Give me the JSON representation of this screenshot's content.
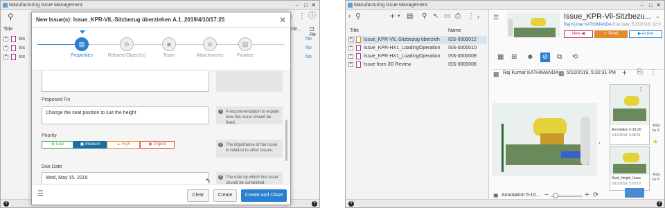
{
  "left_window": {
    "title": "Manufacturing Issue Management",
    "tree_header": "Title",
    "col_partial_1": "erfe...",
    "col_partial_2": "Re",
    "rows": [
      {
        "title": "Iss",
        "value": "No"
      },
      {
        "title": "Iss",
        "value": "No"
      },
      {
        "title": "Iss",
        "value": "No"
      }
    ]
  },
  "dialog": {
    "title": "New Issue(s): Issue_KPR-VIL-Sitzbezug überziehen A.1_2019/4/10/17:25",
    "steps": [
      {
        "label": "Properties",
        "active": true,
        "icon": "clipboard-icon"
      },
      {
        "label": "Related Object(s)",
        "active": false,
        "icon": "link-icon"
      },
      {
        "label": "Team",
        "active": false,
        "icon": "team-icon"
      },
      {
        "label": "Attachments",
        "active": false,
        "icon": "paperclip-icon"
      },
      {
        "label": "Finalize",
        "active": false,
        "icon": "flag-icon"
      }
    ],
    "proposed_fix_label": "Proposed Fix",
    "proposed_fix_value": "Change the seat position to suit the height",
    "proposed_fix_help": "A recommendation to explain how this issue should be fixed.",
    "priority_label": "Priority",
    "priorities": [
      {
        "label": "Low",
        "color": "#3aa856",
        "selected": false
      },
      {
        "label": "Medium",
        "color": "#1a6f9e",
        "selected": true
      },
      {
        "label": "High",
        "color": "#e08a2c",
        "selected": false
      },
      {
        "label": "Urgent",
        "color": "#d9472b",
        "selected": false
      }
    ],
    "priority_help": "The importance of the issue in relation to other issues.",
    "due_date_label": "Due Date",
    "due_date_value": "Wed, May 15, 2019",
    "due_date_help": "The date by which this issue should be completed.",
    "buttons": {
      "clear": "Clear",
      "create": "Create",
      "create_close": "Create and Close"
    }
  },
  "right_window": {
    "title": "Manufacturing Issue Management",
    "col_title": "Title",
    "col_name": "Name",
    "rows": [
      {
        "title": "Issue_KPR-VIL-Sitzbezug überzieh",
        "name": "ISS-0000012",
        "selected": true
      },
      {
        "title": "Issue_KPR-HX1_LoadingOperation",
        "name": "ISS-0000010",
        "selected": false
      },
      {
        "title": "Issue_KPR-HX1_LoadingOperation",
        "name": "ISS-0000009",
        "selected": false
      },
      {
        "title": "Issue from 3D Review",
        "name": "ISS-0000006",
        "selected": false
      }
    ],
    "detail": {
      "title": "Issue_KPR-Vil-Sitzbezu...",
      "subtitle": "Raj Kumar KATHIMANDA",
      "due": "Due date: 5/15/2019, 12:0...",
      "workflow": [
        {
          "label": "New",
          "color": "#c0306c"
        },
        {
          "label": "Pend",
          "color": "#e08a2c"
        },
        {
          "label": "Active",
          "color": "#2a7fd0"
        }
      ],
      "author": "Raj Kumar KATHIMANDA",
      "timestamp": "5/10/2019, 5:30:31 PM",
      "annotation_label": "Annotation 5-10...",
      "thumbs": [
        {
          "caption": "Annotation 5-10-20",
          "time": "5/10/2019, 5:38:31"
        },
        {
          "caption": "Seat_Height_Issue",
          "time": "5/10/2019, 5:29:10"
        }
      ],
      "attach_labels": [
        "Attac",
        "by R",
        "Attac",
        "by R"
      ]
    }
  }
}
